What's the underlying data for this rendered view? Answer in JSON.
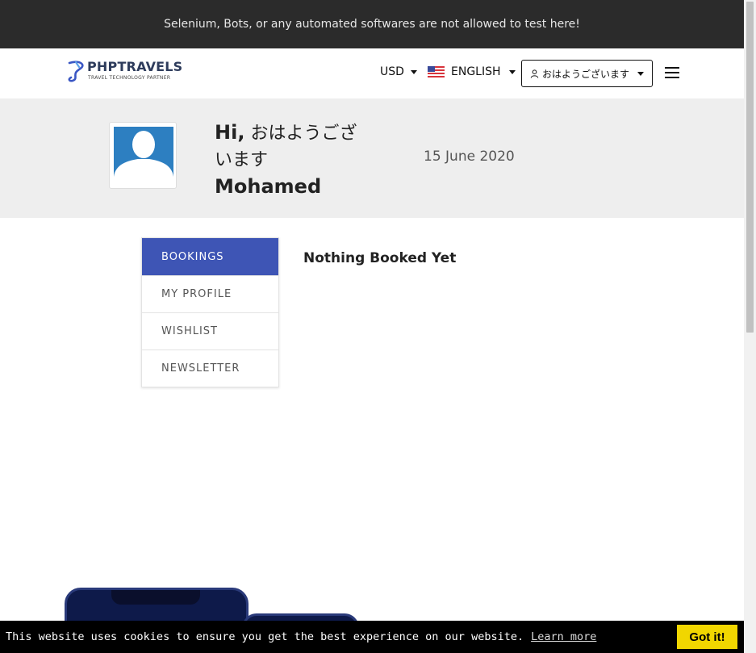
{
  "topbar": {
    "notice": "Selenium, Bots, or any automated softwares are not allowed to test here!"
  },
  "header": {
    "logo_text": "PHPTRAVELS",
    "logo_sub": "TRAVEL TECHNOLOGY PARTNER",
    "currency": "USD",
    "language": "ENGLISH",
    "user_button": "おはようございます",
    "menu_icon": "hamburger-icon"
  },
  "profile": {
    "hi": "Hi,",
    "greeting": "おはようございます",
    "name": "Mohamed",
    "date": "15 June 2020"
  },
  "sidebar": {
    "items": [
      {
        "label": "BOOKINGS",
        "active": true
      },
      {
        "label": "MY PROFILE",
        "active": false
      },
      {
        "label": "WISHLIST",
        "active": false
      },
      {
        "label": "NEWSLETTER",
        "active": false
      }
    ]
  },
  "main": {
    "title": "Nothing Booked Yet"
  },
  "cookie": {
    "message": "This website uses cookies to ensure you get the best experience on our website.",
    "learn_more": "Learn more",
    "accept": "Got it!"
  },
  "colors": {
    "accent": "#3e55b5",
    "topbar_bg": "#2b2b2b",
    "cookie_button": "#f1d600",
    "avatar_bg": "#2d7fc1"
  }
}
